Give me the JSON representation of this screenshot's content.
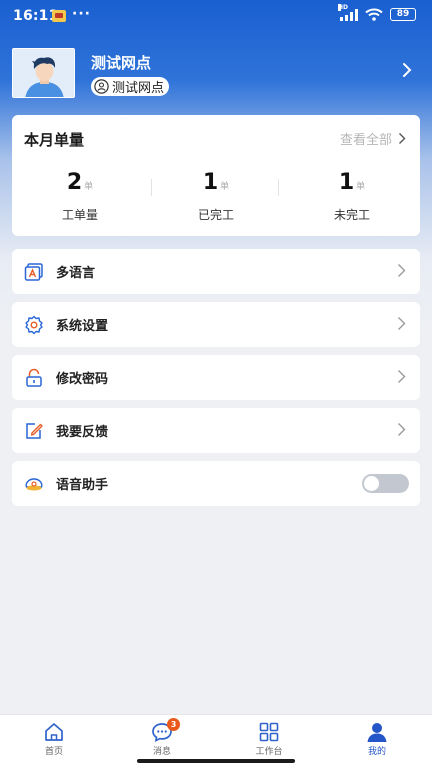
{
  "status_bar": {
    "time": "16:11",
    "dots": "···",
    "network_badge": "HD",
    "battery": "89"
  },
  "profile": {
    "name": "测试网点",
    "tag": "测试网点",
    "avatar_icon": "user-avatar-icon",
    "arrow_icon": "chevron-right-icon"
  },
  "monthly": {
    "title": "本月单量",
    "view_all": "查看全部",
    "stats": [
      {
        "value": "2",
        "unit": "单",
        "label": "工单量"
      },
      {
        "value": "1",
        "unit": "单",
        "label": "已完工"
      },
      {
        "value": "1",
        "unit": "单",
        "label": "未完工"
      }
    ]
  },
  "menu": [
    {
      "label": "多语言",
      "icon": "language-icon"
    },
    {
      "label": "系统设置",
      "icon": "settings-gear-icon"
    },
    {
      "label": "修改密码",
      "icon": "lock-icon"
    },
    {
      "label": "我要反馈",
      "icon": "feedback-edit-icon"
    }
  ],
  "voice_assistant": {
    "label": "语音助手",
    "icon": "voice-assistant-icon",
    "enabled": false
  },
  "tabbar": {
    "items": [
      {
        "label": "首页",
        "icon": "home-icon",
        "active": false
      },
      {
        "label": "消息",
        "icon": "message-icon",
        "active": false,
        "badge": "3"
      },
      {
        "label": "工作台",
        "icon": "workbench-grid-icon",
        "active": false
      },
      {
        "label": "我的",
        "icon": "profile-icon",
        "active": true
      }
    ]
  },
  "colors": {
    "primary": "#1a5fd0",
    "active_tab": "#2456c7",
    "badge": "#e8591a"
  }
}
